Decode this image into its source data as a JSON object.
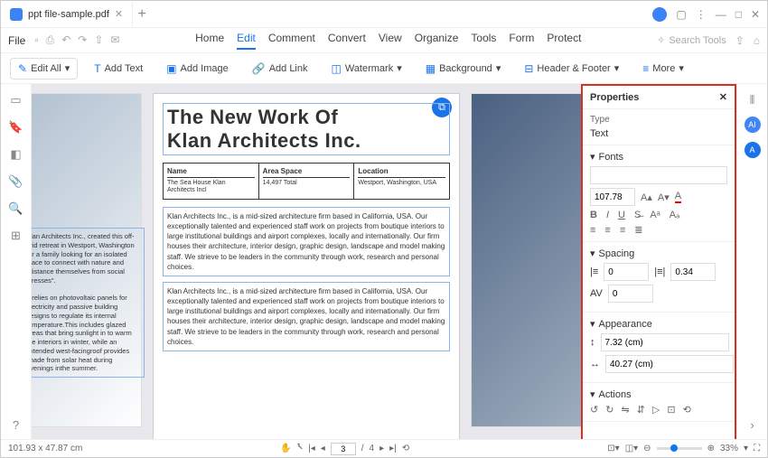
{
  "titlebar": {
    "tab_title": "ppt file-sample.pdf",
    "new_tab": "+",
    "window_controls": [
      "—",
      "□",
      "✕"
    ]
  },
  "menubar": {
    "file": "File",
    "tabs": [
      "Home",
      "Edit",
      "Comment",
      "Convert",
      "View",
      "Organize",
      "Tools",
      "Form",
      "Protect"
    ],
    "active_tab": "Edit",
    "search_placeholder": "Search Tools"
  },
  "toolbar": {
    "edit_all": "Edit All",
    "add_text": "Add Text",
    "add_image": "Add Image",
    "add_link": "Add Link",
    "watermark": "Watermark",
    "background": "Background",
    "header_footer": "Header & Footer",
    "more": "More"
  },
  "document": {
    "title_line1": "The New Work Of",
    "title_line2": "Klan Architects Inc.",
    "table": {
      "cols": [
        {
          "header": "Name",
          "value": "The Sea House Klan Architects Incl"
        },
        {
          "header": "Area Space",
          "value": "14,497 Total"
        },
        {
          "header": "Location",
          "value": "Westport, Washington, USA"
        }
      ]
    },
    "left_text1": "Klan Architects Inc., created this off-grid retreat in Westport, Washington for a family looking for an isolated place to connect with nature and \"distance themselves from social stresses\".",
    "left_text2": "It relies on photovoltaic panels for electricity and passive building designs to regulate its internal temperature.This includes glazed areas that bring sunlight in to warm the interiors in winter, while an extended west-facingroof provides shade from solar heat during evenings inthe summer.",
    "para1": "Klan Architects Inc., is a mid-sized architecture firm based in California, USA. Our exceptionally talented and experienced staff work on projects from boutique interiors to large institutional buildings and airport complexes, locally and internationally. Our firm houses their architecture, interior design, graphic design, landscape and model making staff. We strieve to be leaders in the community through work, research and personal choices.",
    "para2": "Klan Architects Inc., is a mid-sized architecture firm based in California, USA. Our exceptionally talented and experienced staff work on projects from boutique interiors to large institutional buildings and airport complexes, locally and internationally. Our firm houses their architecture, interior design, graphic design, landscape and model making staff. We strieve to be leaders in the community through work, research and personal choices."
  },
  "properties": {
    "title": "Properties",
    "type_label": "Type",
    "type_value": "Text",
    "fonts_label": "Fonts",
    "font_size": "107.78",
    "spacing_label": "Spacing",
    "spacing_val1": "0",
    "spacing_val2": "0.34",
    "spacing_val3": "0",
    "appearance_label": "Appearance",
    "width": "7.32 (cm)",
    "height": "40.27 (cm)",
    "actions_label": "Actions"
  },
  "statusbar": {
    "dimensions": "101.93 x 47.87 cm",
    "page_current": "3",
    "page_total": "4",
    "zoom": "33%"
  }
}
